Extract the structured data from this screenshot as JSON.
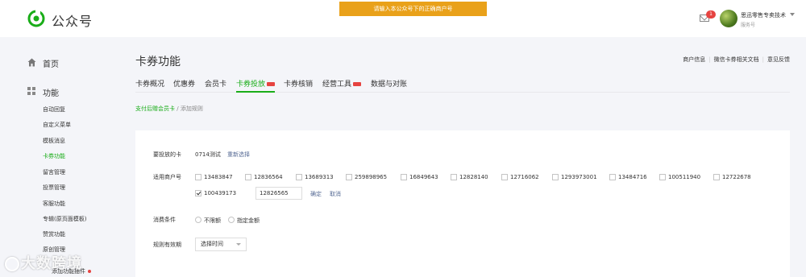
{
  "header": {
    "brand": "公众号",
    "alert": "请输入本公众号下的正确商户号",
    "mail_badge": "1",
    "account_name": "思迅零售专卖技术",
    "account_type": "服务号"
  },
  "sidebar": {
    "home": "首页",
    "function": "功能",
    "items": [
      {
        "label": "自动回复",
        "active": false
      },
      {
        "label": "自定义菜单",
        "active": false
      },
      {
        "label": "模板消息",
        "active": false
      },
      {
        "label": "卡券功能",
        "active": true
      },
      {
        "label": "留言管理",
        "active": false
      },
      {
        "label": "投票管理",
        "active": false
      },
      {
        "label": "客服功能",
        "active": false
      },
      {
        "label": "专辑(原页面模板)",
        "active": false
      },
      {
        "label": "赞赏功能",
        "active": false
      },
      {
        "label": "原创管理",
        "active": false
      },
      {
        "label": "添加功能插件",
        "active": false
      }
    ],
    "watermark": "大数跨境"
  },
  "main": {
    "title": "卡券功能",
    "top_links": [
      "商户信息",
      "微信卡券相关文档",
      "意见反馈"
    ],
    "tabs": [
      {
        "label": "卡券概况",
        "active": false,
        "new": false
      },
      {
        "label": "优惠券",
        "active": false,
        "new": false
      },
      {
        "label": "会员卡",
        "active": false,
        "new": false
      },
      {
        "label": "卡券投放",
        "active": true,
        "new": true
      },
      {
        "label": "卡券核销",
        "active": false,
        "new": false
      },
      {
        "label": "经营工具",
        "active": false,
        "new": true
      },
      {
        "label": "数据与对账",
        "active": false,
        "new": false
      }
    ],
    "breadcrumb": {
      "link": "支付后赠会员卡",
      "separator": "/",
      "current": "添加规则"
    },
    "form": {
      "card_label": "要投放的卡",
      "card_value": "0714测试",
      "reselect": "重新选择",
      "merchant_label": "适用商户号",
      "merchants": [
        {
          "id": "13483847",
          "checked": false
        },
        {
          "id": "12836564",
          "checked": false
        },
        {
          "id": "13689313",
          "checked": false
        },
        {
          "id": "259898965",
          "checked": false
        },
        {
          "id": "16849643",
          "checked": false
        },
        {
          "id": "12828140",
          "checked": false
        },
        {
          "id": "12716062",
          "checked": false
        },
        {
          "id": "1293973001",
          "checked": false
        },
        {
          "id": "13484716",
          "checked": false
        },
        {
          "id": "100511940",
          "checked": false
        },
        {
          "id": "12722678",
          "checked": false
        },
        {
          "id": "100439173",
          "checked": true
        }
      ],
      "merchant_input_value": "12826565",
      "confirm": "确定",
      "cancel": "取消",
      "condition_label": "消费条件",
      "condition_options": [
        "不限额",
        "指定金额"
      ],
      "validity_label": "规则有效期",
      "validity_select": "选择时间"
    }
  }
}
